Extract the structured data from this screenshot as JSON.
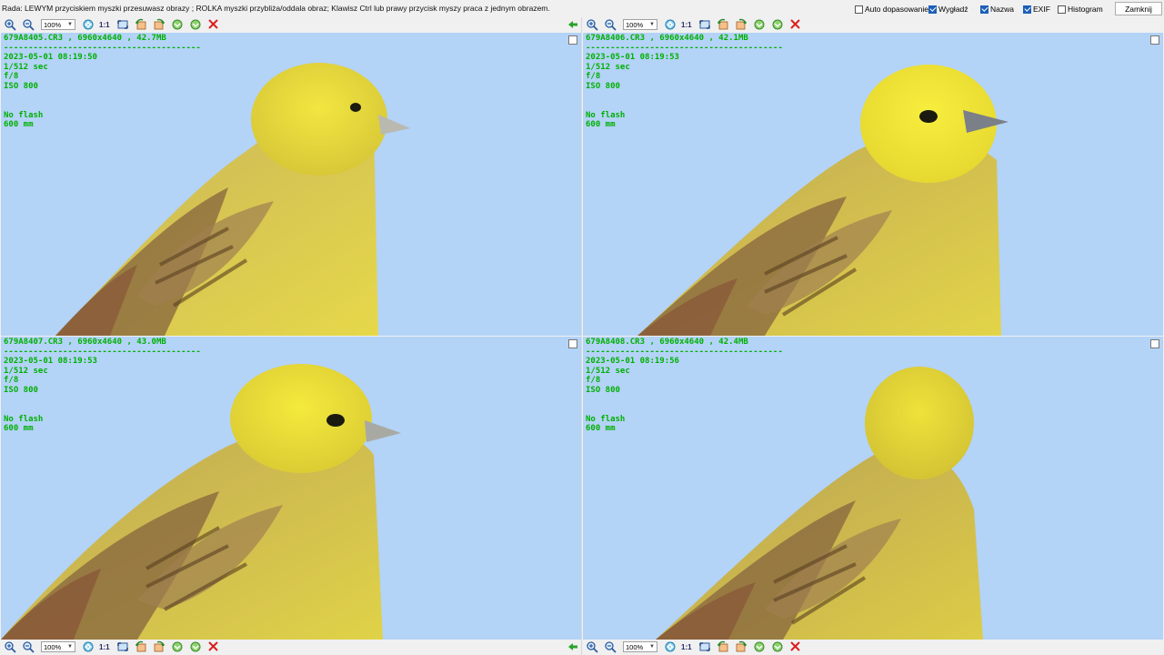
{
  "topbar": {
    "hint": "Rada: LEWYM przyciskiem myszki przesuwasz obrazy ; ROLKA myszki przybliża/oddala obraz; Klawisz Ctrl lub prawy przycisk myszy praca z jednym obrazem.",
    "options": [
      {
        "label": "Auto dopasowanie",
        "checked": false
      },
      {
        "label": "Wygładź",
        "checked": true
      },
      {
        "label": "Nazwa",
        "checked": true
      },
      {
        "label": "EXIF",
        "checked": true
      },
      {
        "label": "Histogram",
        "checked": false
      }
    ],
    "close_label": "Zamknij"
  },
  "toolbar": {
    "zoom_value": "100%",
    "one_to_one": "1:1"
  },
  "panels": [
    {
      "title": "679A8405.CR3 , 6960x4640 , 42.7MB",
      "separator": "----------------------------------------",
      "datetime": "2023-05-01 08:19:50",
      "shutter": "1/512 sec",
      "aperture": "f/8",
      "iso": "ISO 800",
      "flash": "No flash",
      "focal": "600 mm"
    },
    {
      "title": "679A8406.CR3 , 6960x4640 , 42.1MB",
      "separator": "----------------------------------------",
      "datetime": "2023-05-01 08:19:53",
      "shutter": "1/512 sec",
      "aperture": "f/8",
      "iso": "ISO 800",
      "flash": "No flash",
      "focal": "600 mm"
    },
    {
      "title": "679A8407.CR3 , 6960x4640 , 43.0MB",
      "separator": "----------------------------------------",
      "datetime": "2023-05-01 08:19:53",
      "shutter": "1/512 sec",
      "aperture": "f/8",
      "iso": "ISO 800",
      "flash": "No flash",
      "focal": "600 mm"
    },
    {
      "title": "679A8408.CR3 , 6960x4640 , 42.4MB",
      "separator": "----------------------------------------",
      "datetime": "2023-05-01 08:19:56",
      "shutter": "1/512 sec",
      "aperture": "f/8",
      "iso": "ISO 800",
      "flash": "No flash",
      "focal": "600 mm"
    }
  ],
  "colors": {
    "sky": "#b3d3f7",
    "overlay_text": "#00b000",
    "bird_yellow": "#e8e23a",
    "bird_olive": "#b8a54a",
    "bird_brown": "#8a5a3a"
  }
}
